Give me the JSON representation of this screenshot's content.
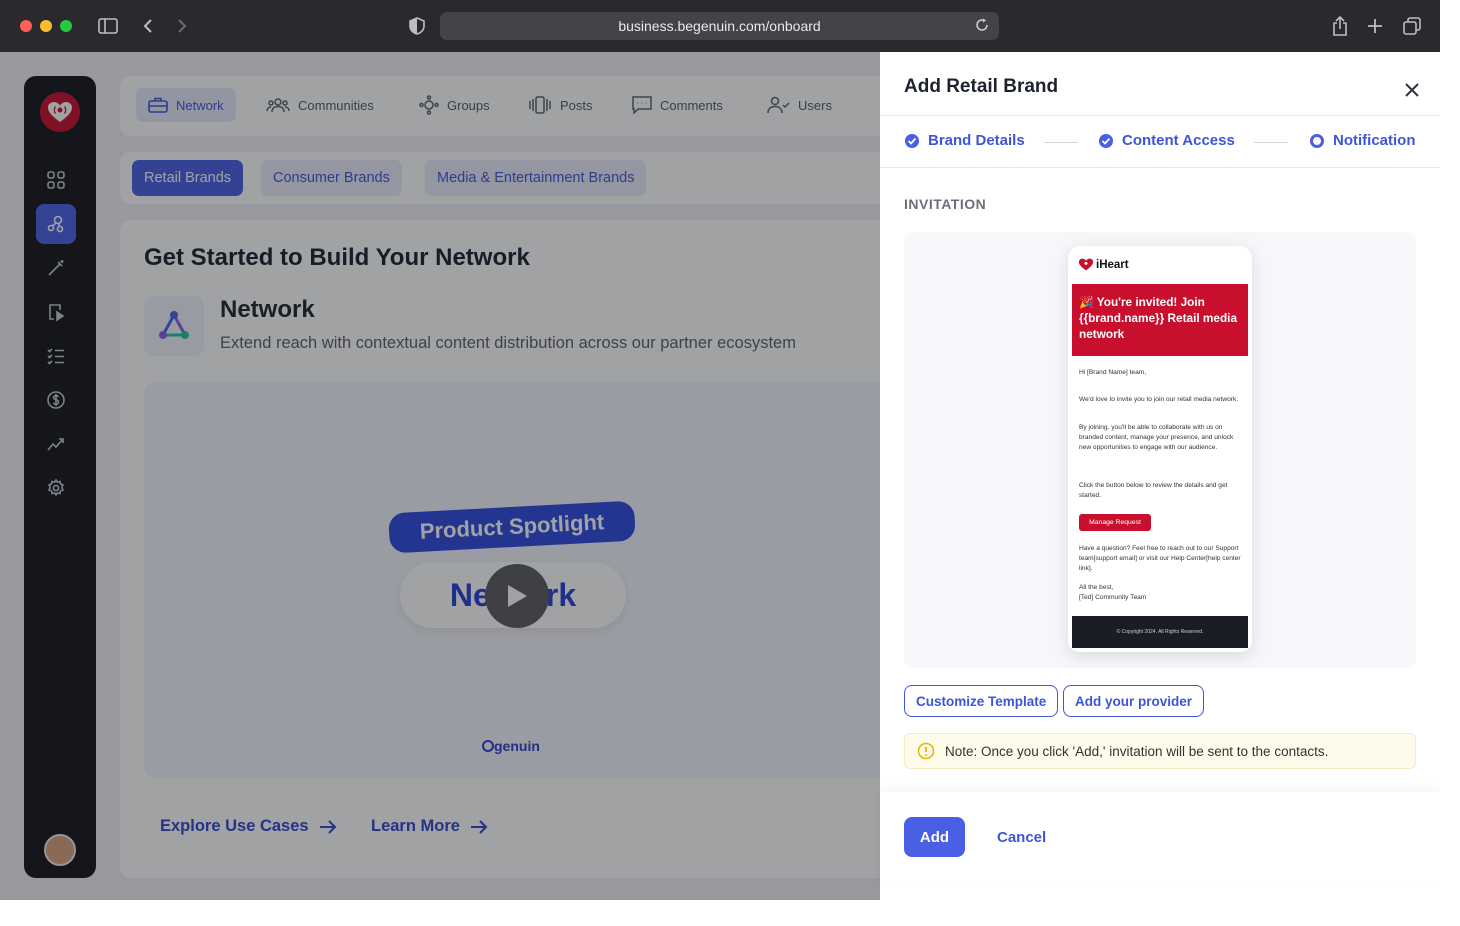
{
  "browser": {
    "url": "business.begenuin.com/onboard"
  },
  "topnav": {
    "items": [
      {
        "label": "Network",
        "icon": "briefcase-icon",
        "active": true
      },
      {
        "label": "Communities",
        "icon": "people-icon"
      },
      {
        "label": "Groups",
        "icon": "hub-icon"
      },
      {
        "label": "Posts",
        "icon": "video-stack-icon"
      },
      {
        "label": "Comments",
        "icon": "comment-icon"
      },
      {
        "label": "Users",
        "icon": "users-icon"
      }
    ]
  },
  "subtabs": [
    {
      "label": "Retail Brands",
      "active": true
    },
    {
      "label": "Consumer Brands"
    },
    {
      "label": "Media & Entertainment Brands"
    }
  ],
  "main": {
    "title": "Get Started to Build Your Network",
    "network_title": "Network",
    "network_desc": "Extend reach with contextual content distribution across our partner ecosystem",
    "video": {
      "pill": "Product Spotlight",
      "word": "Network",
      "brand": "genuin"
    },
    "links": [
      {
        "label": "Explore Use Cases"
      },
      {
        "label": "Learn More"
      }
    ]
  },
  "panel": {
    "title": "Add Retail Brand",
    "steps": [
      {
        "label": "Brand Details",
        "state": "done"
      },
      {
        "label": "Content Access",
        "state": "done"
      },
      {
        "label": "Notification",
        "state": "current"
      }
    ],
    "section_label": "INVITATION",
    "email": {
      "logo": "iHeart",
      "banner": "🎉 You're invited! Join {{brand.name}} Retail media network",
      "greeting": "Hi [Brand Name] team,",
      "p1": "We'd love to invite you to join our retail media network.",
      "p2": "By joining, you'll be able to collaborate with us on branded content, manage your presence, and unlock new opportunities to engage with our audience.",
      "p3": "Click the button below to review the details and get started.",
      "button": "Manage Request",
      "p4": "Have a question? Feel free to reach out to our Support team[support email] or visit our Help Center[help center link].",
      "signoff1": "All the best,",
      "signoff2": "[Ted] Community Team",
      "footer": "© Copyright 2024. All Rights Reserved."
    },
    "customize_btn": "Customize Template",
    "provider_btn": "Add your provider",
    "note": "Note: Once you click 'Add,' invitation will be sent to the contacts.",
    "add_btn": "Add",
    "cancel_btn": "Cancel"
  },
  "colors": {
    "accent": "#4a60e4",
    "brand_red": "#c8102e",
    "sidebar_bg": "#16171b"
  }
}
